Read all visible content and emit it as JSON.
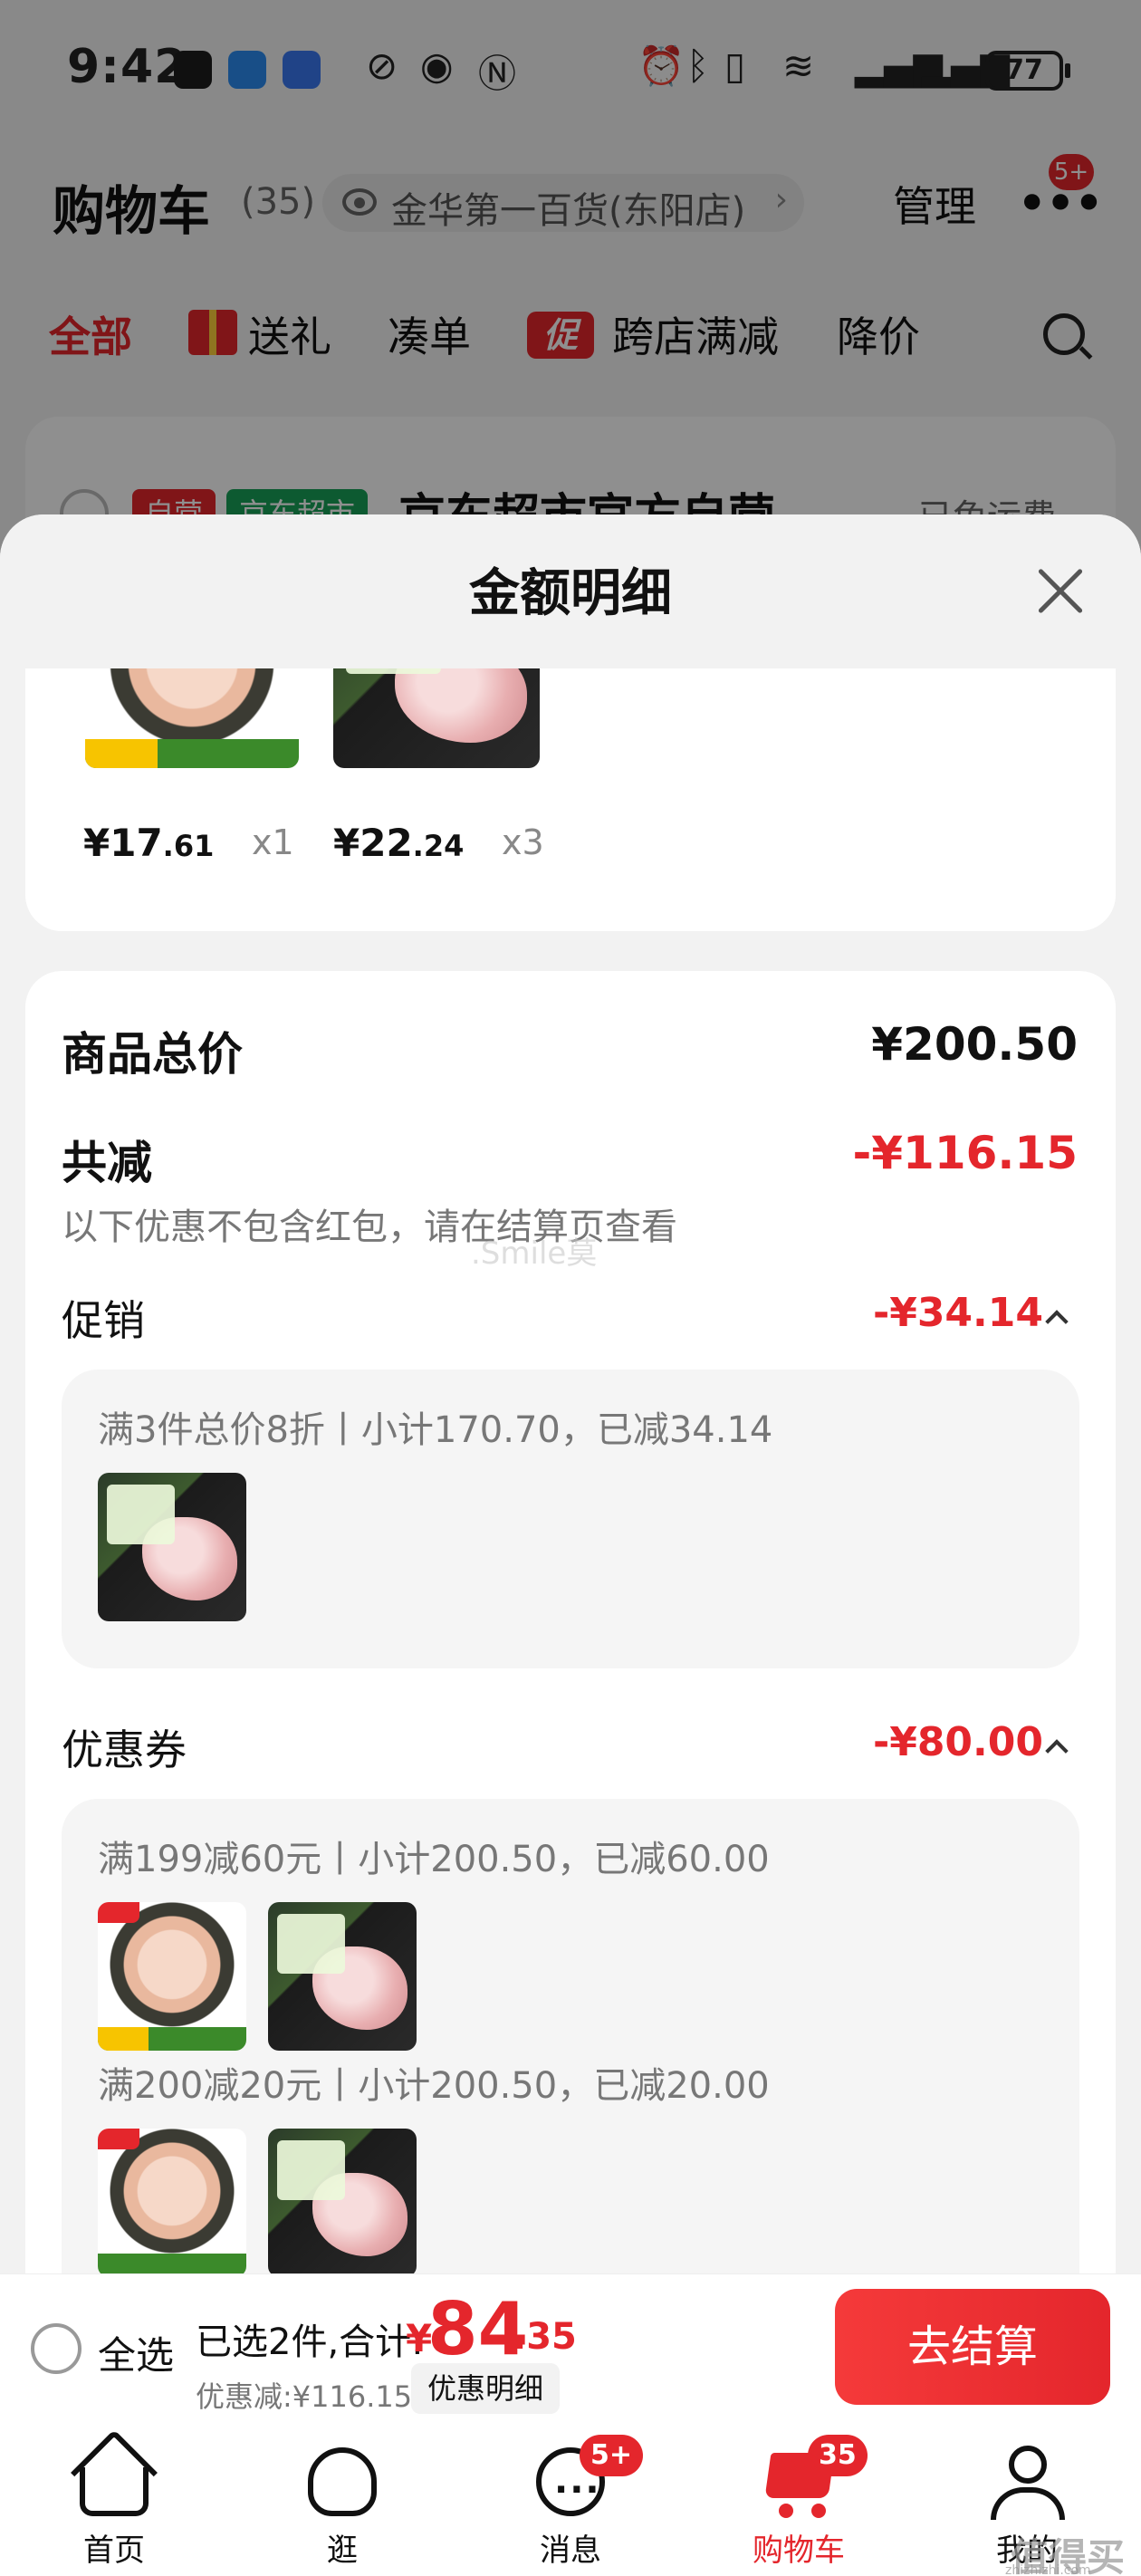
{
  "status_bar": {
    "time": "9:42",
    "battery": "77",
    "icons": [
      "qq-icon",
      "message-icon",
      "data-sync-icon",
      "nfc-icon",
      "eye-comfort-icon",
      "alarm-icon",
      "bluetooth-icon",
      "vibrate-icon",
      "wifi-icon",
      "signal-icon",
      "signal-icon"
    ]
  },
  "cart_header": {
    "title": "购物车",
    "count": "(35)",
    "store": "金华第一百货(东阳店)",
    "manage": "管理",
    "more_badge": "5+"
  },
  "cart_tabs": [
    "全部",
    "送礼",
    "凑单",
    "跨店满减",
    "降价"
  ],
  "cart_tabs_promo_icon": "促",
  "store_card": {
    "tag_self": "自营",
    "tag_market": "京东超市",
    "name": "京东超市官方自营",
    "shipping": "已免运费"
  },
  "sheet": {
    "title": "金额明细",
    "items": [
      {
        "price_int": "¥17",
        "price_dec": ".61",
        "qty": "x1"
      },
      {
        "price_int": "¥22",
        "price_dec": ".24",
        "qty": "x3"
      }
    ],
    "goods_total_label": "商品总价",
    "goods_total_value": "¥200.50",
    "reduce_label": "共减",
    "reduce_value": "-¥116.15",
    "reduce_note": "以下优惠不包含红包，请在结算页查看",
    "watermark": ".Smile莫",
    "promo_label": "促销",
    "promo_value": "-¥34.14",
    "promo_line": "满3件总价8折丨小计170.70，已减34.14",
    "coupon_label": "优惠券",
    "coupon_value": "-¥80.00",
    "coupon_lines": [
      "满199减60元丨小计200.50，已减60.00",
      "满200减20元丨小计200.50，已减20.00"
    ]
  },
  "checkout_bar": {
    "select_all": "全选",
    "selected": "已选2件,合计:",
    "yen": "¥",
    "total_int": "84",
    "total_dec": ".35",
    "discount": "优惠减:¥116.15",
    "detail": "优惠明细",
    "checkout": "去结算"
  },
  "tabbar": [
    {
      "label": "首页",
      "icon": "home-icon"
    },
    {
      "label": "逛",
      "icon": "explore-icon"
    },
    {
      "label": "消息",
      "icon": "message-icon",
      "badge": "5+"
    },
    {
      "label": "购物车",
      "icon": "cart-icon",
      "badge": "35"
    },
    {
      "label": "我的",
      "icon": "profile-icon"
    }
  ],
  "corner_watermark": "值得买",
  "corner_watermark_url": "zhizhizhi.com",
  "colors": {
    "accent": "#e4262c",
    "background": "#f2f2f2"
  }
}
